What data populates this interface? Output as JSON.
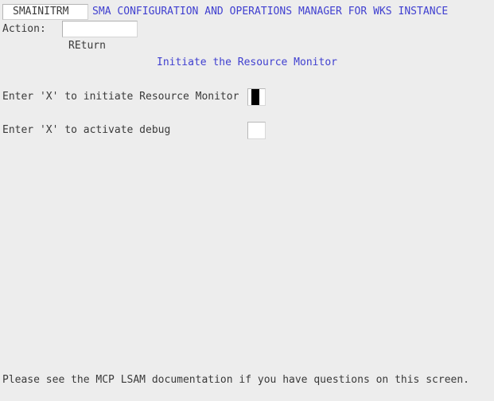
{
  "header": {
    "screen_id": "SMAINITRM",
    "title": "SMA CONFIGURATION AND OPERATIONS MANAGER FOR WKS INSTANCE",
    "title_color": "#4040d0"
  },
  "action": {
    "label": "Action:",
    "value": "",
    "placeholder": "",
    "hint": "REturn"
  },
  "panel": {
    "title": "Initiate the Resource Monitor",
    "title_color": "#4040d0"
  },
  "fields": [
    {
      "label": "Enter 'X' to initiate Resource Monitor",
      "value": "",
      "focused": true
    },
    {
      "label": "Enter 'X' to activate debug",
      "value": "",
      "focused": false
    }
  ],
  "footer": {
    "message": "Please see the MCP LSAM documentation if you have questions on this screen."
  },
  "colors": {
    "background": "#ededed",
    "text": "#3a3a3a",
    "accent_blue": "#4040d0",
    "field_background": "#ffffff",
    "cursor": "#000000"
  }
}
